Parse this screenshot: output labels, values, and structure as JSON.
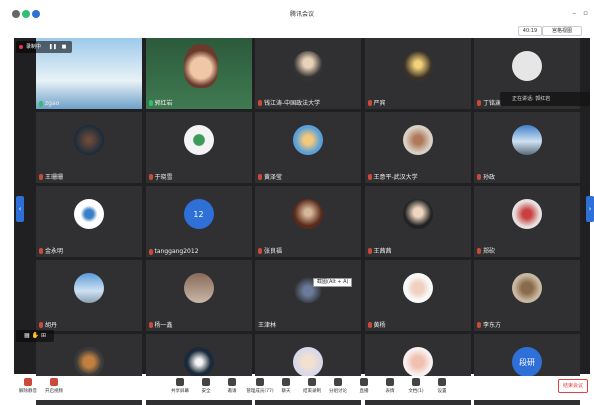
{
  "window": {
    "title": "腾讯会议"
  },
  "top": {
    "timer": "40:19",
    "view_label": "宫格视图"
  },
  "recording": {
    "label": "录制中"
  },
  "speaking": {
    "label": "正在讲话: 郭红岩"
  },
  "tooltip": {
    "label": "截图(Alt + A)"
  },
  "tiles": [
    {
      "name": "zgao",
      "avatar": "landscape",
      "mic": "on"
    },
    {
      "name": "郭红岩",
      "avatar": "photo-woman",
      "mic": "on"
    },
    {
      "name": "钱江涛-中国政法大学",
      "avatar": "person",
      "mic": "off"
    },
    {
      "name": "严宾",
      "avatar": "lamp",
      "mic": "off"
    },
    {
      "name": "丁铭澜",
      "avatar": "blank",
      "mic": "off"
    },
    {
      "name": "王珊珊",
      "avatar": "lights",
      "mic": "off"
    },
    {
      "name": "于晓雪",
      "avatar": "leaf",
      "mic": "off"
    },
    {
      "name": "黄泽莹",
      "avatar": "cartoon",
      "mic": "off"
    },
    {
      "name": "王意平-武汉大学",
      "avatar": "umbrella",
      "mic": "off"
    },
    {
      "name": "孙政",
      "avatar": "mountain",
      "mic": "off"
    },
    {
      "name": "金永明",
      "avatar": "logo",
      "mic": "off"
    },
    {
      "name": "tanggang2012",
      "avatar": "number",
      "avatar_text": "12",
      "mic": "off"
    },
    {
      "name": "张良福",
      "avatar": "speaker",
      "mic": "off"
    },
    {
      "name": "王茜茜",
      "avatar": "girl",
      "mic": "off"
    },
    {
      "name": "郑砍",
      "avatar": "flowers",
      "mic": "off"
    },
    {
      "name": "胡丹",
      "avatar": "sky",
      "mic": "off"
    },
    {
      "name": "杨一鑫",
      "avatar": "room",
      "mic": "off"
    },
    {
      "name": "王津林",
      "avatar": "blank-dark",
      "mic": "none"
    },
    {
      "name": "黄杨",
      "avatar": "anime",
      "mic": "off"
    },
    {
      "name": "李东方",
      "avatar": "cat",
      "mic": "off"
    },
    {
      "name": "",
      "avatar": "tiger",
      "mic": "none"
    },
    {
      "name": "",
      "avatar": "phone",
      "mic": "none"
    },
    {
      "name": "",
      "avatar": "woman2",
      "mic": "none"
    },
    {
      "name": "",
      "avatar": "doll",
      "mic": "none"
    },
    {
      "name": "",
      "avatar": "text",
      "avatar_text": "段研",
      "mic": "none"
    }
  ],
  "bottom": {
    "buttons": [
      {
        "label": "解除静音"
      },
      {
        "label": "开启视频"
      },
      {
        "label": "共享屏幕"
      },
      {
        "label": "安全"
      },
      {
        "label": "邀请"
      },
      {
        "label": "管理成员(77)"
      },
      {
        "label": "聊天"
      },
      {
        "label": "结束录制"
      },
      {
        "label": "分组讨论"
      },
      {
        "label": "直播"
      },
      {
        "label": "表情"
      },
      {
        "label": "文档(1)"
      },
      {
        "label": "设置"
      }
    ],
    "leave_label": "结束会议"
  },
  "colors": {
    "accent": "#2f6fd8",
    "danger": "#e04040",
    "stage_bg": "#202023",
    "tile_bg": "#303033"
  }
}
